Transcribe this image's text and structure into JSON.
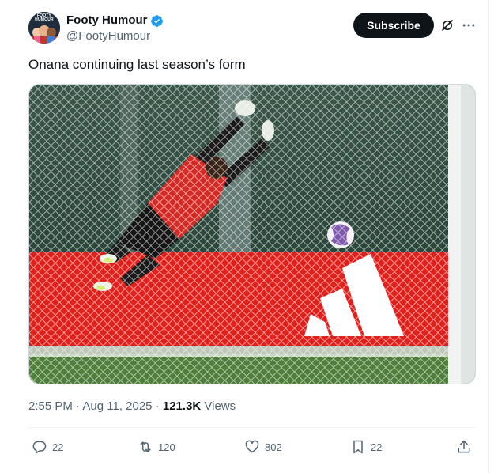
{
  "author": {
    "display_name": "Footy Humour",
    "handle": "@FootyHumour",
    "avatar_text": "FOOTY HUMOUR"
  },
  "header": {
    "subscribe_label": "Subscribe",
    "grok_icon": "grok-icon",
    "more_icon": "more-icon"
  },
  "tweet": {
    "text": "Onana continuing last season’s form",
    "time": "2:55 PM",
    "separator": "·",
    "date": "Aug 11, 2025",
    "views_count": "121.3K",
    "views_label": "Views"
  },
  "media": {
    "alt_icon": "photo",
    "colors": {
      "board_red": "#e0201b",
      "wall_green": "#2f4a3f",
      "kit_red": "#d42a25",
      "grass": "#4f7f3a"
    }
  },
  "actions": {
    "replies": "22",
    "reposts": "120",
    "likes": "802",
    "bookmarks": "22"
  },
  "colors": {
    "text": "#0f1419",
    "secondary": "#536471",
    "verified": "#1d9bf0"
  }
}
